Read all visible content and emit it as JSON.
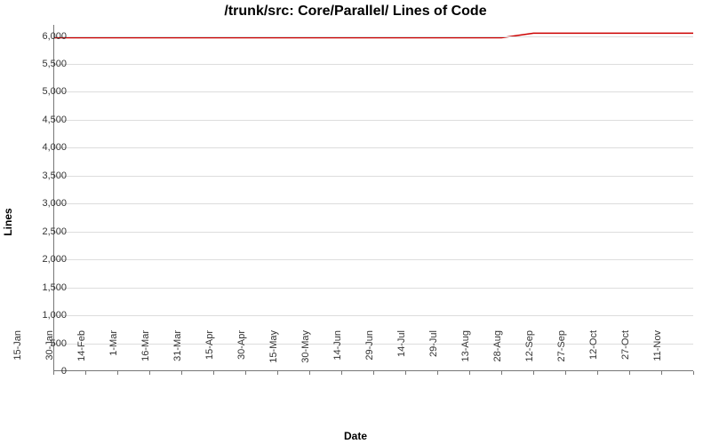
{
  "chart_data": {
    "type": "line",
    "title": "/trunk/src: Core/Parallel/ Lines of Code",
    "xlabel": "Date",
    "ylabel": "Lines",
    "ylim": [
      0,
      6200
    ],
    "y_ticks": [
      0,
      500,
      1000,
      1500,
      2000,
      2500,
      3000,
      3500,
      4000,
      4500,
      5000,
      5500,
      6000
    ],
    "y_tick_labels": [
      "0",
      "500",
      "1,000",
      "1,500",
      "2,000",
      "2,500",
      "3,000",
      "3,500",
      "4,000",
      "4,500",
      "5,000",
      "5,500",
      "6,000"
    ],
    "x_tick_labels": [
      "15-Jan",
      "30-Jan",
      "14-Feb",
      "1-Mar",
      "16-Mar",
      "31-Mar",
      "15-Apr",
      "30-Apr",
      "15-May",
      "30-May",
      "14-Jun",
      "29-Jun",
      "14-Jul",
      "29-Jul",
      "13-Aug",
      "28-Aug",
      "12-Sep",
      "27-Sep",
      "12-Oct",
      "27-Oct",
      "11-Nov"
    ],
    "series": [
      {
        "name": "Lines of Code",
        "color": "#cc0000",
        "x": [
          "15-Jan",
          "30-Jan",
          "14-Feb",
          "1-Mar",
          "16-Mar",
          "31-Mar",
          "15-Apr",
          "30-Apr",
          "15-May",
          "30-May",
          "14-Jun",
          "29-Jun",
          "14-Jul",
          "29-Jul",
          "13-Aug",
          "28-Aug",
          "12-Sep",
          "27-Sep",
          "12-Oct",
          "27-Oct",
          "11-Nov"
        ],
        "y": [
          5970,
          5970,
          5970,
          5970,
          5970,
          5970,
          5970,
          5970,
          5970,
          5970,
          5970,
          5970,
          5970,
          5970,
          5970,
          6050,
          6050,
          6050,
          6050,
          6050,
          6050
        ]
      }
    ]
  }
}
